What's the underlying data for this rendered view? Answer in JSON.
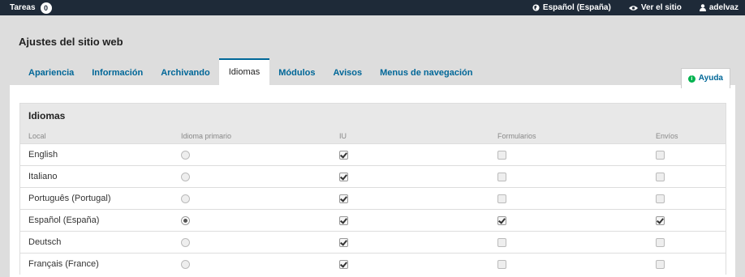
{
  "topbar": {
    "tasks_label": "Tareas",
    "tasks_count": "0",
    "language": "Español (España)",
    "view_site": "Ver el sitio",
    "user": "adelvaz"
  },
  "page": {
    "title": "Ajustes del sitio web"
  },
  "tabs": [
    {
      "label": "Apariencia",
      "active": false
    },
    {
      "label": "Información",
      "active": false
    },
    {
      "label": "Archivando",
      "active": false
    },
    {
      "label": "Idiomas",
      "active": true
    },
    {
      "label": "Módulos",
      "active": false
    },
    {
      "label": "Avisos",
      "active": false
    },
    {
      "label": "Menus de navegación",
      "active": false
    }
  ],
  "help": {
    "label": "Ayuda"
  },
  "languages": {
    "title": "Idiomas",
    "headers": [
      "Local",
      "Idioma primario",
      "IU",
      "Formularios",
      "Envíos"
    ],
    "rows": [
      {
        "locale": "English",
        "primary": false,
        "ui": true,
        "forms": false,
        "submissions": false
      },
      {
        "locale": "Italiano",
        "primary": false,
        "ui": true,
        "forms": false,
        "submissions": false
      },
      {
        "locale": "Português (Portugal)",
        "primary": false,
        "ui": true,
        "forms": false,
        "submissions": false
      },
      {
        "locale": "Español (España)",
        "primary": true,
        "ui": true,
        "forms": true,
        "submissions": true
      },
      {
        "locale": "Deutsch",
        "primary": false,
        "ui": true,
        "forms": false,
        "submissions": false
      },
      {
        "locale": "Français (France)",
        "primary": false,
        "ui": true,
        "forms": false,
        "submissions": false
      }
    ]
  },
  "colors": {
    "topbar": "#1e2a38",
    "accent": "#006798",
    "help_icon": "#00b24e"
  }
}
